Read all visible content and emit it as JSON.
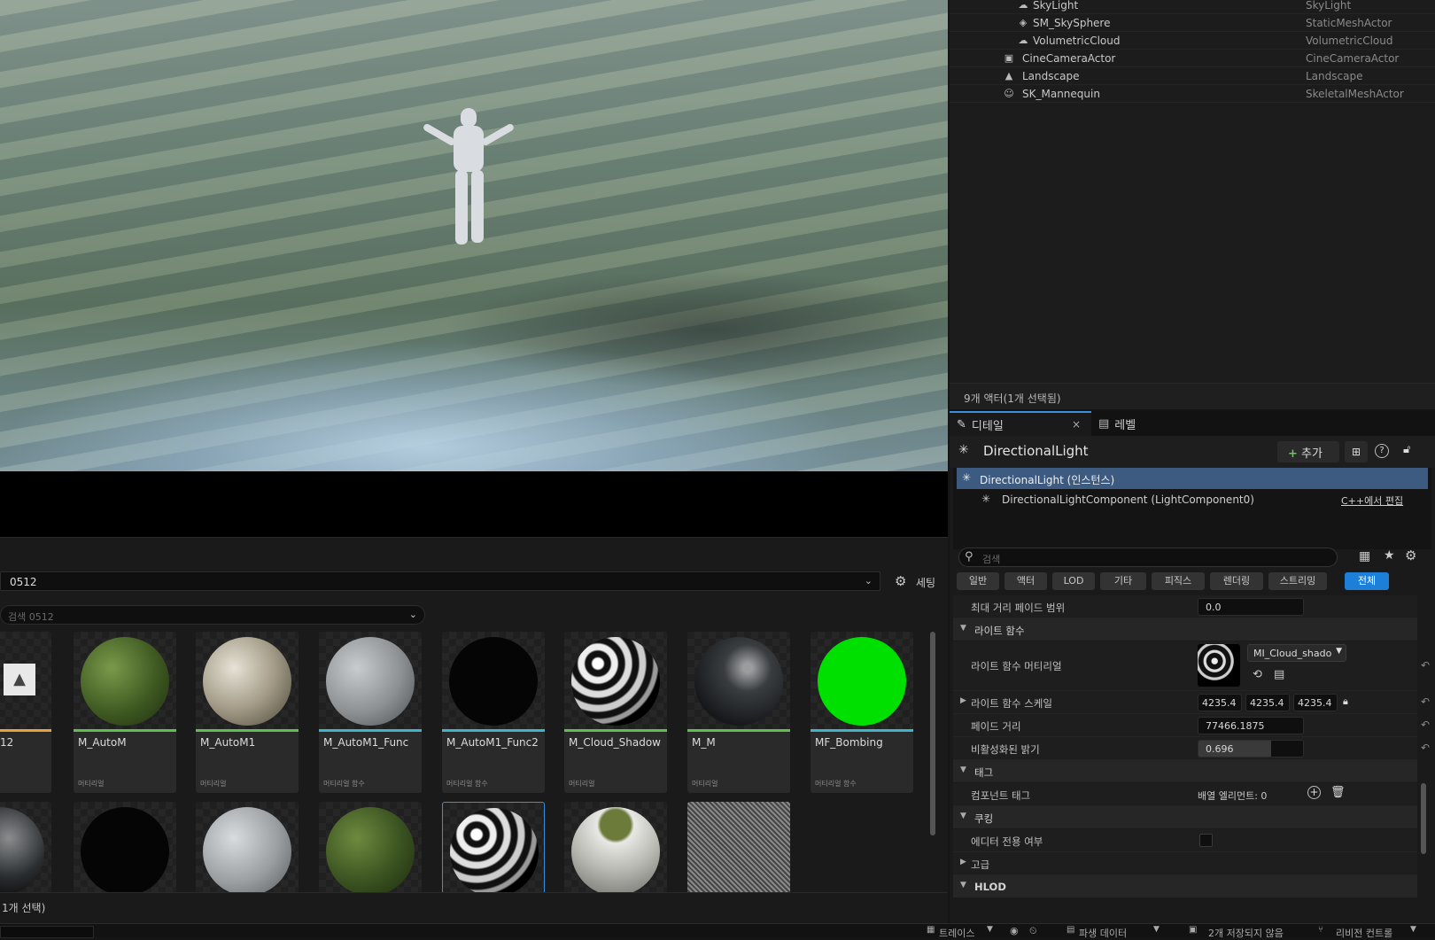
{
  "outliner": {
    "rows": [
      {
        "name": "SkyLight",
        "type": "SkyLight",
        "icon": "skylight-icon"
      },
      {
        "name": "SM_SkySphere",
        "type": "StaticMeshActor",
        "icon": "static-mesh-icon"
      },
      {
        "name": "VolumetricCloud",
        "type": "VolumetricCloud",
        "icon": "cloud-icon"
      },
      {
        "name": "CineCameraActor",
        "type": "CineCameraActor",
        "icon": "camera-icon"
      },
      {
        "name": "Landscape",
        "type": "Landscape",
        "icon": "landscape-icon"
      },
      {
        "name": "SK_Mannequin",
        "type": "SkeletalMeshActor",
        "icon": "skeletal-mesh-icon"
      }
    ],
    "status": "9개 액터(1개 선택됨)"
  },
  "details": {
    "tab_details": "디테일",
    "tab_level": "레벨",
    "actor_name": "DirectionalLight",
    "add_label": "추가",
    "instance_label": "DirectionalLight (인스턴스)",
    "component_label": "DirectionalLightComponent (LightComponent0)",
    "edit_cpp": "C++에서 편집",
    "search_placeholder": "검색",
    "filters": [
      "일반",
      "액터",
      "LOD",
      "기타",
      "피직스",
      "렌더링",
      "스트리밍",
      "전체"
    ],
    "props": {
      "max_distance_fade_label": "최대 거리 페이드 범위",
      "max_distance_fade_value": "0.0",
      "light_function_section": "라이트 함수",
      "light_function_material_label": "라이트 함수 머티리얼",
      "light_function_material_value": "MI_Cloud_shado",
      "light_function_scale_label": "라이트 함수 스케일",
      "scale_x": "4235.4",
      "scale_y": "4235.4",
      "scale_z": "4235.4",
      "fade_distance_label": "페이드 거리",
      "fade_distance_value": "77466.1875",
      "disabled_brightness_label": "비활성화된 밝기",
      "disabled_brightness_value": "0.696",
      "disabled_brightness_fraction": 0.696,
      "tags_section": "태그",
      "component_tags_label": "컴포넌트 태그",
      "component_tags_value": "배열 엘리먼트: 0",
      "cooking_section": "쿠킹",
      "editor_only_label": "에디터 전용 여부",
      "advanced_section": "고급",
      "hlod_section": "HLOD"
    }
  },
  "content_browser": {
    "path": "0512",
    "settings_label": "세팅",
    "search_placeholder": "검색 0512",
    "status": "1개 선택)",
    "assets_row1": [
      {
        "name": "12",
        "type": "",
        "bar": "#e8a33a"
      },
      {
        "name": "M_AutoM",
        "type": "머티리얼",
        "bar": "#5fbf4f"
      },
      {
        "name": "M_AutoM1",
        "type": "머티리얼",
        "bar": "#5fbf4f"
      },
      {
        "name": "M_AutoM1_Func",
        "type": "머티리얼 함수",
        "bar": "#3fb5c9"
      },
      {
        "name": "M_AutoM1_Func2",
        "type": "머티리얼 함수",
        "bar": "#3fb5c9"
      },
      {
        "name": "M_Cloud_Shadow",
        "type": "머티리얼",
        "bar": "#5fbf4f"
      },
      {
        "name": "M_M",
        "type": "머티리얼",
        "bar": "#5fbf4f"
      },
      {
        "name": "MF_Bombing",
        "type": "머티리얼 함수",
        "bar": "#3fb5c9"
      }
    ]
  },
  "status_bar": {
    "trace": "트레이스",
    "derived_data": "파생 데이터",
    "unsaved": "2개 저장되지 않음",
    "revision_control": "리비전 컨트롤"
  }
}
